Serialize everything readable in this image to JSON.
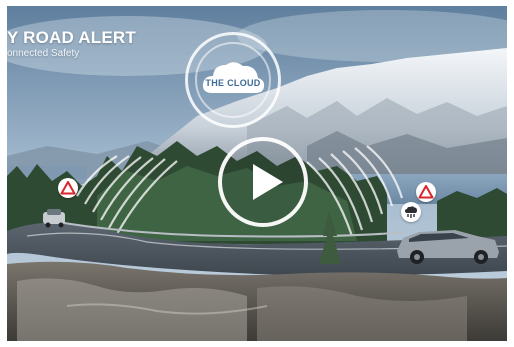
{
  "video": {
    "title": "Y ROAD ALERT",
    "subtitle": "onnected Safety",
    "cloud_label": "THE CLOUD"
  },
  "icons": {
    "play": "play-icon",
    "cloud": "cloud-icon",
    "hazard": "hazard-warning-icon",
    "share": "cloud-share-icon"
  },
  "colors": {
    "hazard_red": "#d8262c",
    "cloud_text": "#3e6b94"
  }
}
